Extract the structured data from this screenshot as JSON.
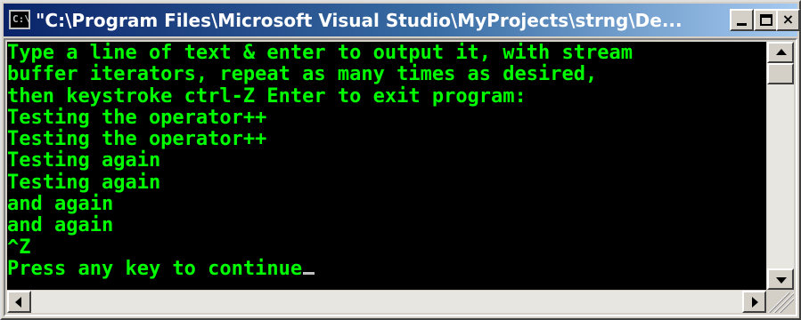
{
  "window": {
    "title": "\"C:\\Program Files\\Microsoft Visual Studio\\MyProjects\\strng\\De...",
    "icon_text": "C:\\",
    "icon": "console-icon",
    "buttons": {
      "minimize": "minimize-icon",
      "maximize": "maximize-icon",
      "close": "×"
    }
  },
  "console": {
    "lines": [
      "Type a line of text & enter to output it, with stream",
      "buffer iterators, repeat as many times as desired,",
      "then keystroke ctrl-Z Enter to exit program:",
      "Testing the operator++",
      "Testing the operator++",
      "Testing again",
      "Testing again",
      "and again",
      "and again",
      "^Z",
      "Press any key to continue"
    ],
    "colors": {
      "background": "#000000",
      "text": "#00ff00"
    }
  },
  "scrollbars": {
    "vertical": "vertical-scrollbar",
    "horizontal": "horizontal-scrollbar"
  },
  "colors": {
    "title_start": "#0a246a",
    "title_end": "#a6caf0",
    "chrome": "#d4d0c8"
  }
}
